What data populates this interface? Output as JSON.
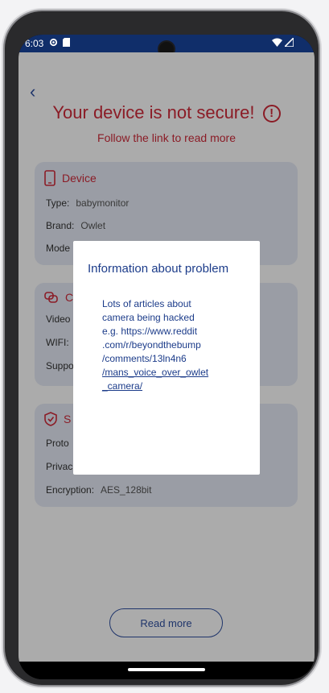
{
  "status_bar": {
    "time": "6:03"
  },
  "header": {
    "back_glyph": "‹",
    "title": "Your device is not secure!",
    "warn_glyph": "!",
    "subtitle": "Follow the link to read more"
  },
  "cards": [
    {
      "heading": "Device",
      "icon": "phone-icon",
      "rows": [
        {
          "label": "Type:",
          "value": "babymonitor"
        },
        {
          "label": "Brand:",
          "value": "Owlet"
        },
        {
          "label": "Mode",
          "value": ""
        }
      ]
    },
    {
      "heading": "C",
      "icon": "link-icon",
      "rows": [
        {
          "label": "Video",
          "value": ""
        },
        {
          "label": "WIFI:",
          "value": ""
        },
        {
          "label": "Suppo",
          "value": ""
        }
      ]
    },
    {
      "heading": "S",
      "icon": "shield-check-icon",
      "rows": [
        {
          "label": "Proto",
          "value": ""
        },
        {
          "label": "Privac",
          "value": ""
        },
        {
          "label": "Encryption:",
          "value": "AES_128bit"
        }
      ]
    }
  ],
  "read_more_button": "Read more",
  "dialog": {
    "title": "Information about problem",
    "lines": [
      "Lots of articles about",
      "camera being hacked",
      "e.g. https://www.reddit",
      ".com/r/beyondthebump",
      "/comments/13ln4n6"
    ],
    "link_lines": [
      "/mans_voice_over_owlet",
      "_camera/"
    ]
  },
  "colors": {
    "accent_blue": "#2f4fa0",
    "alert_red": "#cf2a3a",
    "card_bg": "#e6ebf6",
    "status_bar": "#102e6a"
  }
}
